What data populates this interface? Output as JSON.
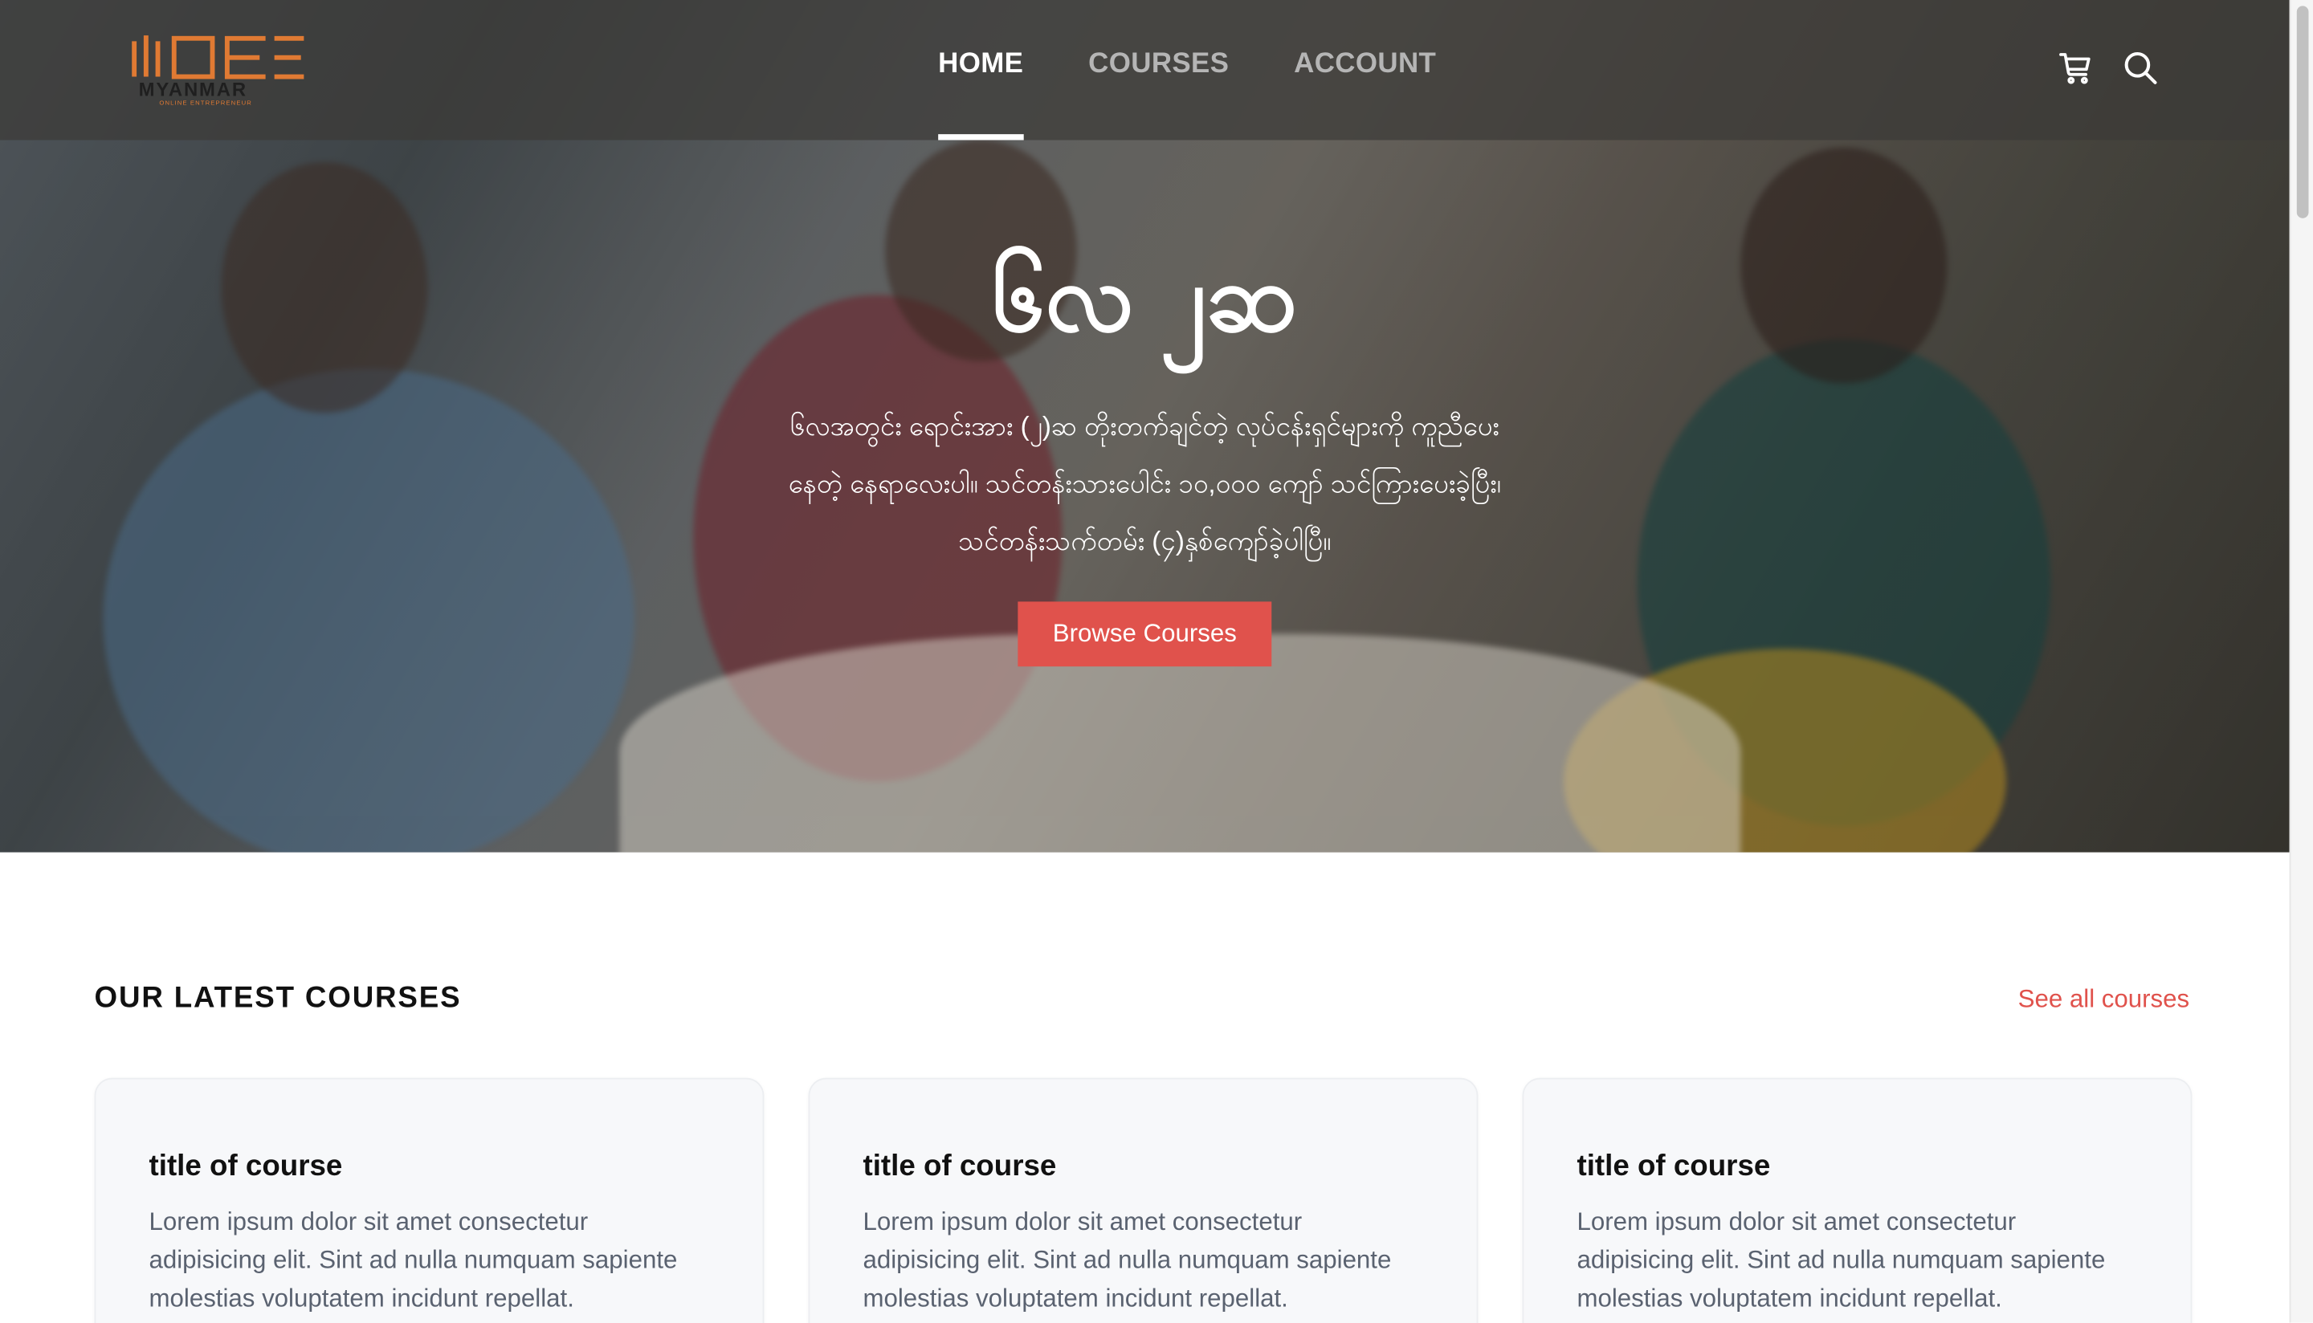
{
  "brand": {
    "logo_text": "MOE",
    "logo_subtext": "MYANMAR",
    "logo_tagline": "ONLINE ENTREPRENEUR",
    "accent_color": "#e0524c",
    "logo_color": "#e07a33"
  },
  "nav": {
    "items": [
      {
        "label": "HOME",
        "active": true
      },
      {
        "label": "COURSES",
        "active": false
      },
      {
        "label": "ACCOUNT",
        "active": false
      }
    ],
    "icons": [
      "cart-icon",
      "search-icon"
    ]
  },
  "hero": {
    "title": "၆လ ၂ဆ",
    "description": "၆လအတွင်း ရောင်းအား (၂)ဆ တိုးတက်ချင်တဲ့ လုပ်ငန်းရှင်များကို ကူညီပေးနေတဲ့ နေရာလေးပါ။ သင်တန်းသားပေါင်း ၁၀,၀၀၀ ကျော် သင်ကြားပေးခဲ့ပြီး၊ သင်တန်းသက်တမ်း (၄)နှစ်ကျော်ခဲ့ပါပြီ။",
    "cta_label": "Browse Courses"
  },
  "courses": {
    "section_title": "OUR LATEST COURSES",
    "see_all_label": "See all courses",
    "items": [
      {
        "title": "title of course",
        "description": "Lorem ipsum dolor sit amet consectetur adipisicing elit. Sint ad nulla numquam sapiente molestias voluptatem incidunt repellat."
      },
      {
        "title": "title of course",
        "description": "Lorem ipsum dolor sit amet consectetur adipisicing elit. Sint ad nulla numquam sapiente molestias voluptatem incidunt repellat."
      },
      {
        "title": "title of course",
        "description": "Lorem ipsum dolor sit amet consectetur adipisicing elit. Sint ad nulla numquam sapiente molestias voluptatem incidunt repellat."
      }
    ]
  }
}
